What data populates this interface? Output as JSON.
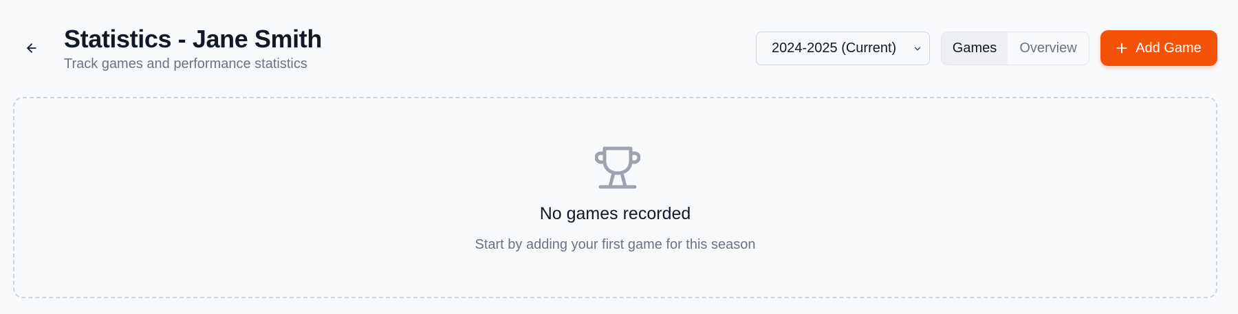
{
  "header": {
    "title": "Statistics - Jane Smith",
    "subtitle": "Track games and performance statistics"
  },
  "season_select": {
    "selected": "2024-2025 (Current)"
  },
  "view_tabs": [
    {
      "label": "Games",
      "active": true
    },
    {
      "label": "Overview",
      "active": false
    }
  ],
  "add_button": {
    "label": "Add Game",
    "color": "#f45209"
  },
  "empty_state": {
    "icon": "trophy-icon",
    "title": "No games recorded",
    "message": "Start by adding your first game for this season"
  }
}
